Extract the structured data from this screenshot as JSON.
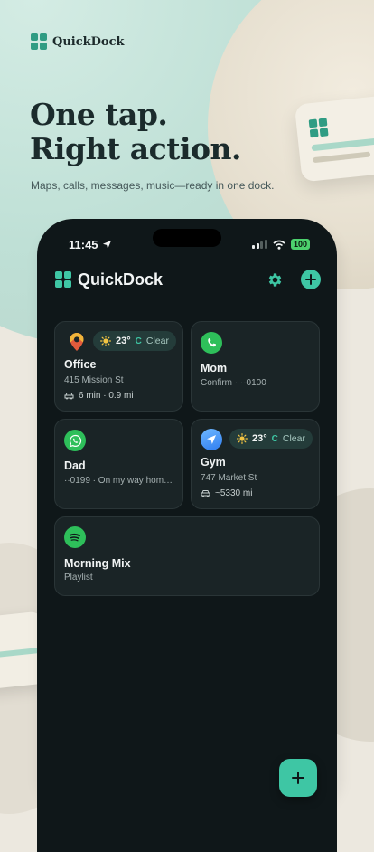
{
  "brand": {
    "name": "QuickDock"
  },
  "hero": {
    "line1": "One tap.",
    "line2": "Right action.",
    "subtitle": "Maps, calls, messages, music—ready in one dock."
  },
  "status_bar": {
    "time": "11:45",
    "battery": "100"
  },
  "app": {
    "title": "QuickDock",
    "settings_icon": "gear-icon",
    "add_icon": "plus-icon"
  },
  "colors": {
    "accent": "#3ec6a4",
    "background": "#0f1719",
    "card": "#1a2426",
    "green": "#2ebf5a"
  },
  "cards": [
    {
      "title": "Office",
      "subtitle": "415 Mission St",
      "meta": "6 min · 0.9 mi",
      "icon": "map-pin-icon",
      "weather": {
        "temp": "23°",
        "unit": "C",
        "condition": "Clear"
      }
    },
    {
      "title": "Mom",
      "subtitle": "Confirm · ··0100",
      "icon": "phone-icon"
    },
    {
      "title": "Dad",
      "subtitle": "··0199 · On my way hom…",
      "icon": "whatsapp-icon"
    },
    {
      "title": "Gym",
      "subtitle": "747 Market St",
      "meta": "~5330 mi",
      "icon": "maps-arrow-icon",
      "weather": {
        "temp": "23°",
        "unit": "C",
        "condition": "Clear"
      }
    },
    {
      "title": "Morning Mix",
      "subtitle": "Playlist",
      "icon": "spotify-icon"
    }
  ]
}
